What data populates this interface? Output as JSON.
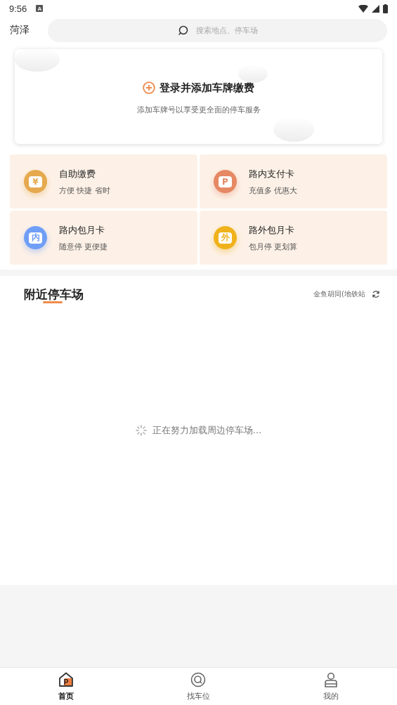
{
  "status_bar": {
    "time": "9:56",
    "notification_letter": "A"
  },
  "header": {
    "city": "菏泽",
    "search": {
      "placeholder": "搜索地点、停车场"
    }
  },
  "login_card": {
    "title": "登录并添加车牌缴费",
    "subtitle": "添加车牌号以享受更全面的停车服务"
  },
  "services": [
    {
      "title": "自助缴费",
      "subtitle": "方便 快捷 省时",
      "icon_text": "¥",
      "color": "#e6a94e"
    },
    {
      "title": "路内支付卡",
      "subtitle": "充值多 优惠大",
      "icon_text": "P",
      "color": "#e58863"
    },
    {
      "title": "路内包月卡",
      "subtitle": "随意停 更便捷",
      "icon_text": "内",
      "color": "#6f9ef7"
    },
    {
      "title": "路外包月卡",
      "subtitle": "包月停 更划算",
      "icon_text": "外",
      "color": "#f0b21c"
    }
  ],
  "nearby": {
    "title": "附近停车场",
    "location": "金鱼胡同(地铁站",
    "loading_text": "正在努力加载周边停车场..."
  },
  "tab_bar": [
    {
      "label": "首页",
      "kind": "home",
      "icon_text": "P",
      "selected": true
    },
    {
      "label": "找车位",
      "kind": "find",
      "selected": false
    },
    {
      "label": "我的",
      "kind": "me",
      "selected": false
    }
  ]
}
